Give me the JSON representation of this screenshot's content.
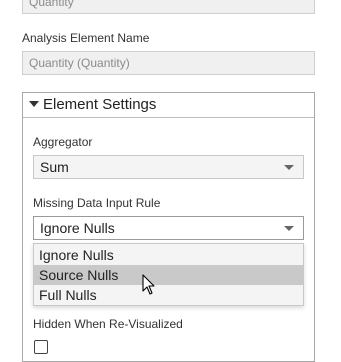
{
  "top_field": {
    "value": "Quantity"
  },
  "analysis_element_name": {
    "label": "Analysis Element Name",
    "value": "Quantity (Quantity)"
  },
  "element_settings": {
    "header": "Element Settings",
    "aggregator": {
      "label": "Aggregator",
      "value": "Sum"
    },
    "missing_data_rule": {
      "label": "Missing Data Input Rule",
      "value": "Ignore Nulls",
      "options": [
        "Ignore Nulls",
        "Source Nulls",
        "Full Nulls"
      ],
      "hovered": "Source Nulls"
    },
    "hidden_when_revisualized": {
      "label": "Hidden When Re-Visualized",
      "checked": false
    }
  },
  "icons": {
    "collapse": "triangle-down-icon",
    "dropdown": "chevron-down-icon",
    "cursor": "mouse-pointer-icon"
  }
}
